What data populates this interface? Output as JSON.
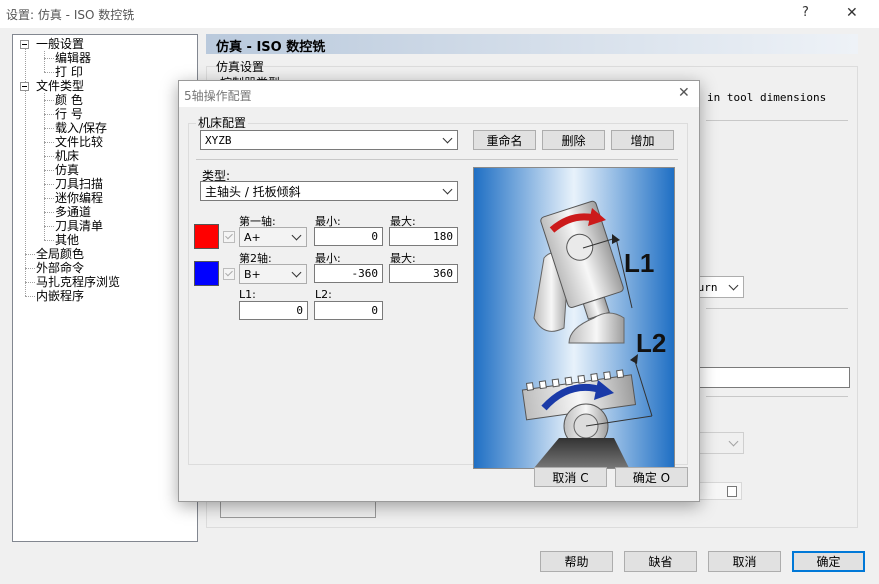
{
  "window": {
    "title": "设置: 仿真 - ISO 数控铣",
    "help_glyph": "?",
    "close_glyph": "✕"
  },
  "tree": {
    "items": [
      {
        "label": "一般设置",
        "level": 0
      },
      {
        "label": "编辑器",
        "level": 1
      },
      {
        "label": "打  印",
        "level": 1
      },
      {
        "label": "文件类型",
        "level": 0
      },
      {
        "label": "颜  色",
        "level": 1
      },
      {
        "label": "行  号",
        "level": 1
      },
      {
        "label": "载入/保存",
        "level": 1
      },
      {
        "label": "文件比较",
        "level": 1
      },
      {
        "label": "机床",
        "level": 1
      },
      {
        "label": "仿真",
        "level": 1
      },
      {
        "label": "刀具扫描",
        "level": 1
      },
      {
        "label": "迷你编程",
        "level": 1
      },
      {
        "label": "多通道",
        "level": 1
      },
      {
        "label": "刀具清单",
        "level": 1
      },
      {
        "label": "其他",
        "level": 1
      },
      {
        "label": "全局颜色",
        "level": 0
      },
      {
        "label": "外部命令",
        "level": 0
      },
      {
        "label": "马扎克程序浏览",
        "level": 0
      },
      {
        "label": "内嵌程序",
        "level": 0
      }
    ]
  },
  "panel": {
    "header": "仿真 - ISO 数控铣",
    "group_title": "仿真设置",
    "controller_label": "控制器类型",
    "tool_dims_text": "in tool dimensions",
    "return_combo": "turn"
  },
  "bottom_buttons": {
    "help": "帮助",
    "default": "缺省",
    "cancel": "取消",
    "ok": "确定"
  },
  "dialog": {
    "title": "5轴操作配置",
    "close_glyph": "✕",
    "machine_group": "机床配置",
    "machine_value": "XYZB",
    "rename": "重命名",
    "delete": "删除",
    "add": "增加",
    "type_label": "类型:",
    "type_value": "主轴头 / 托板倾斜",
    "axis1": {
      "label": "第一轴:",
      "value": "A+",
      "min_label": "最小:",
      "min": "0",
      "max_label": "最大:",
      "max": "180",
      "color": "#ff0000"
    },
    "axis2": {
      "label": "第2轴:",
      "value": "B+",
      "min_label": "最小:",
      "min": "-360",
      "max_label": "最大:",
      "max": "360",
      "color": "#0000ff"
    },
    "l1_label": "L1:",
    "l1": "0",
    "l2_label": "L2:",
    "l2": "0",
    "diagram": {
      "label_l1": "L1",
      "label_l2": "L2",
      "arrow1_color": "#cc1a1a",
      "arrow2_color": "#1a3aa8"
    },
    "cancel": "取消 C",
    "ok": "确定 O"
  }
}
